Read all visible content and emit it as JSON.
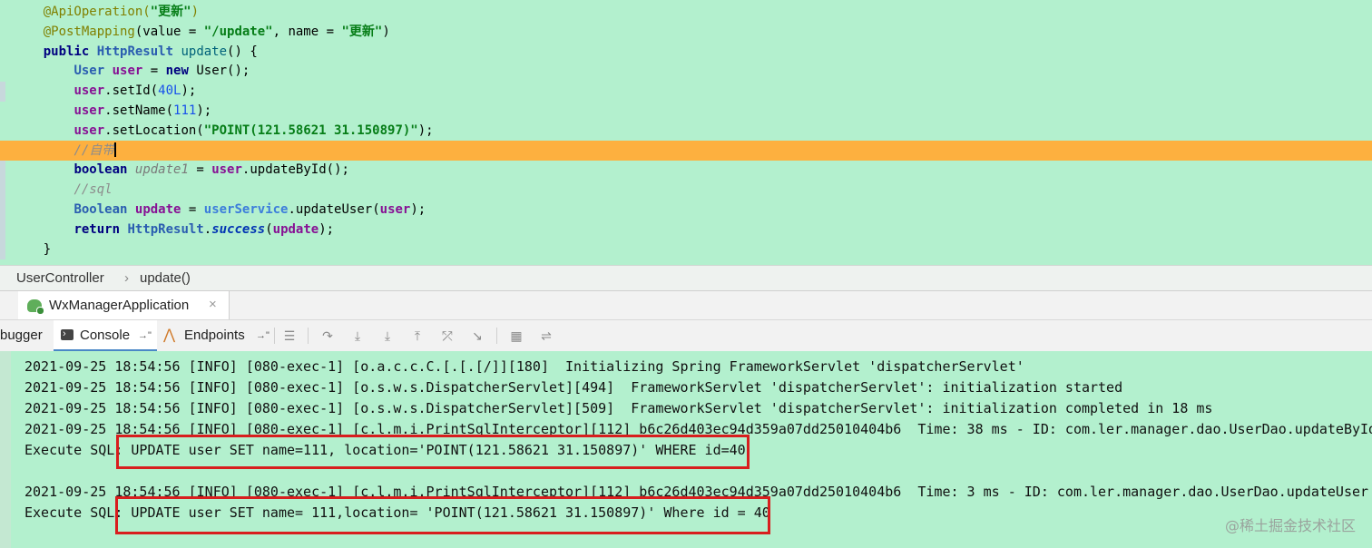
{
  "editor": {
    "lines": [
      {
        "id": "l1",
        "segments": [
          {
            "t": "    "
          },
          {
            "t": "@ApiOperation(",
            "c": "ann"
          },
          {
            "t": "\"更新\"",
            "c": "str"
          },
          {
            "t": ")",
            "c": "ann"
          }
        ]
      },
      {
        "id": "l2",
        "segments": [
          {
            "t": "    "
          },
          {
            "t": "@PostMapping",
            "c": "ann"
          },
          {
            "t": "(value = "
          },
          {
            "t": "\"/update\"",
            "c": "str"
          },
          {
            "t": ", name = "
          },
          {
            "t": "\"更新\"",
            "c": "str"
          },
          {
            "t": ")"
          }
        ]
      },
      {
        "id": "l3",
        "segments": [
          {
            "t": "    "
          },
          {
            "t": "public",
            "c": "kw"
          },
          {
            "t": " "
          },
          {
            "t": "HttpResult",
            "c": "type"
          },
          {
            "t": " "
          },
          {
            "t": "update",
            "c": "method"
          },
          {
            "t": "() {"
          }
        ]
      },
      {
        "id": "l4",
        "segments": [
          {
            "t": "        "
          },
          {
            "t": "User",
            "c": "type"
          },
          {
            "t": " "
          },
          {
            "t": "user",
            "c": "var"
          },
          {
            "t": " = "
          },
          {
            "t": "new",
            "c": "kw"
          },
          {
            "t": " User();"
          }
        ]
      },
      {
        "id": "l5",
        "segments": [
          {
            "t": "        "
          },
          {
            "t": "user",
            "c": "var"
          },
          {
            "t": ".setId("
          },
          {
            "t": "40L",
            "c": "num"
          },
          {
            "t": ");"
          }
        ]
      },
      {
        "id": "l6",
        "segments": [
          {
            "t": "        "
          },
          {
            "t": "user",
            "c": "var"
          },
          {
            "t": ".setName("
          },
          {
            "t": "111",
            "c": "num"
          },
          {
            "t": ");"
          }
        ]
      },
      {
        "id": "l7",
        "segments": [
          {
            "t": "        "
          },
          {
            "t": "user",
            "c": "var"
          },
          {
            "t": ".setLocation("
          },
          {
            "t": "\"POINT(121.58621 31.150897)\"",
            "c": "str"
          },
          {
            "t": ");"
          }
        ]
      },
      {
        "id": "l8",
        "highlight": true,
        "caret": true,
        "segments": [
          {
            "t": "        "
          },
          {
            "t": "//自带",
            "c": "cmt"
          }
        ]
      },
      {
        "id": "l9",
        "segments": [
          {
            "t": "        "
          },
          {
            "t": "boolean",
            "c": "kw"
          },
          {
            "t": " "
          },
          {
            "t": "update1",
            "c": "unused"
          },
          {
            "t": " = "
          },
          {
            "t": "user",
            "c": "var"
          },
          {
            "t": ".updateById();"
          }
        ]
      },
      {
        "id": "l10",
        "segments": [
          {
            "t": "        "
          },
          {
            "t": "//sql",
            "c": "cmt"
          }
        ]
      },
      {
        "id": "l11",
        "segments": [
          {
            "t": "        "
          },
          {
            "t": "Boolean",
            "c": "type"
          },
          {
            "t": " "
          },
          {
            "t": "update",
            "c": "var"
          },
          {
            "t": " = "
          },
          {
            "t": "userService",
            "c": "fld"
          },
          {
            "t": ".updateUser("
          },
          {
            "t": "user",
            "c": "var"
          },
          {
            "t": ");"
          }
        ]
      },
      {
        "id": "l12",
        "segments": [
          {
            "t": "        "
          },
          {
            "t": "return",
            "c": "kw"
          },
          {
            "t": " "
          },
          {
            "t": "HttpResult",
            "c": "type"
          },
          {
            "t": "."
          },
          {
            "t": "success",
            "c": "stat"
          },
          {
            "t": "("
          },
          {
            "t": "update",
            "c": "var"
          },
          {
            "t": ");"
          }
        ]
      },
      {
        "id": "l13",
        "segments": [
          {
            "t": "    }"
          }
        ]
      }
    ]
  },
  "breadcrumb": {
    "class_name": "UserController",
    "separator": "›",
    "method_name": "update()"
  },
  "run_panel": {
    "tab_label": "WxManagerApplication",
    "close_glyph": "×"
  },
  "toolbar": {
    "debugger_label": "bugger",
    "console_label": "Console",
    "console_pin": "→\"",
    "endpoints_label": "Endpoints",
    "endpoints_pin": "→\"",
    "icons": [
      "menu-icon",
      "step-over-icon",
      "step-into-icon",
      "force-step-into-icon",
      "step-out-icon",
      "drop-frame-icon",
      "run-to-cursor-icon",
      "evaluate-icon",
      "trace-icon"
    ]
  },
  "console": {
    "lines": [
      "2021-09-25 18:54:56 [INFO] [080-exec-1] [o.a.c.c.C.[.[.[/]][180]  Initializing Spring FrameworkServlet 'dispatcherServlet'",
      "2021-09-25 18:54:56 [INFO] [080-exec-1] [o.s.w.s.DispatcherServlet][494]  FrameworkServlet 'dispatcherServlet': initialization started",
      "2021-09-25 18:54:56 [INFO] [080-exec-1] [o.s.w.s.DispatcherServlet][509]  FrameworkServlet 'dispatcherServlet': initialization completed in 18 ms",
      "2021-09-25 18:54:56 [INFO] [080-exec-1] [c.l.m.i.PrintSqlInterceptor][112] b6c26d403ec94d359a07dd25010404b6  Time: 38 ms - ID: com.ler.manager.dao.UserDao.updateById",
      "Execute SQL: UPDATE user SET name=111, location='POINT(121.58621 31.150897)' WHERE id=40",
      "",
      "2021-09-25 18:54:56 [INFO] [080-exec-1] [c.l.m.i.PrintSqlInterceptor][112] b6c26d403ec94d359a07dd25010404b6  Time: 3 ms - ID: com.ler.manager.dao.UserDao.updateUser",
      "Execute SQL: UPDATE user SET name= 111,location= 'POINT(121.58621 31.150897)' Where id = 40"
    ]
  },
  "watermark": "@稀土掘金技术社区",
  "colors": {
    "editor_bg": "#b3f0ce",
    "highlight_line": "#fdb03f",
    "annotation_box": "#d81e1e"
  }
}
